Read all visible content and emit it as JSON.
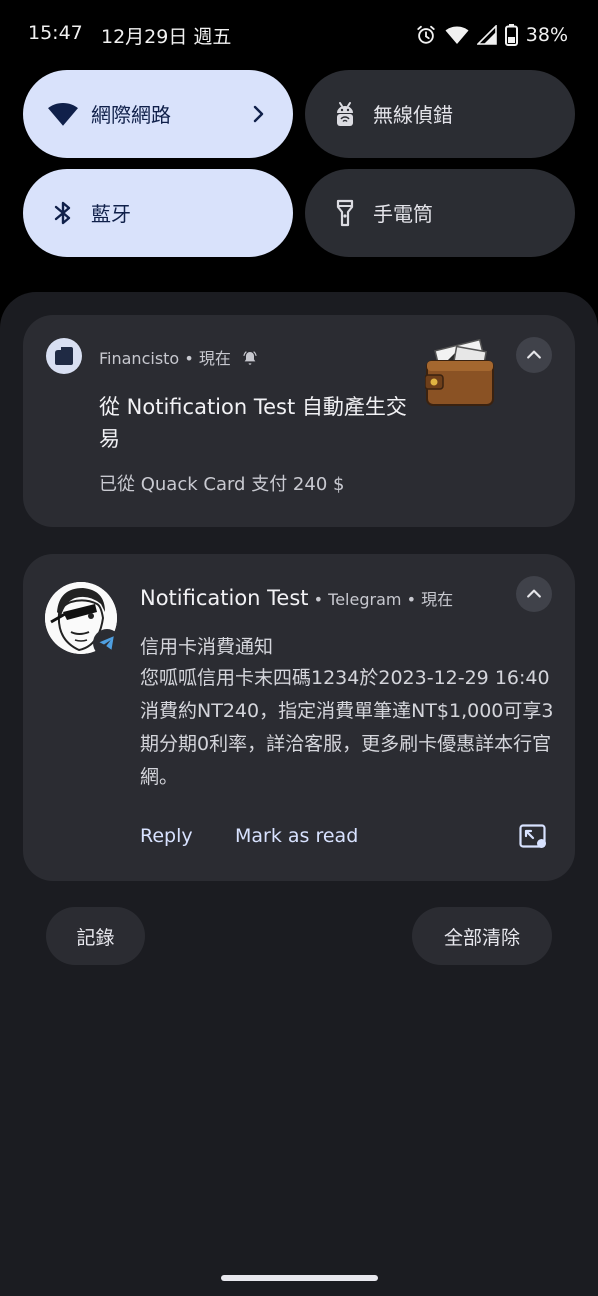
{
  "status_bar": {
    "time": "15:47",
    "date": "12月29日 週五",
    "battery": "38%",
    "icons": [
      "alarm-icon",
      "wifi-icon",
      "cell-signal-icon",
      "battery-icon"
    ]
  },
  "quick_settings": {
    "tiles": [
      {
        "label": "網際網路",
        "icon": "wifi-icon",
        "state": "active"
      },
      {
        "label": "無線偵錯",
        "icon": "android-debug-icon",
        "state": "inactive"
      },
      {
        "label": "藍牙",
        "icon": "bluetooth-icon",
        "state": "active"
      },
      {
        "label": "手電筒",
        "icon": "flashlight-icon",
        "state": "inactive"
      }
    ]
  },
  "notifications": [
    {
      "app": "Financisto",
      "time": "現在",
      "title": "從 Notification Test 自動產生交易",
      "body": "已從 Quack Card 支付 240 $"
    },
    {
      "sender": "Notification Test",
      "app": "Telegram",
      "time": "現在",
      "message_title": "信用卡消費通知",
      "message_body": "您呱呱信用卡末四碼1234於2023-12-29 16:40消費約NT240，指定消費單筆達NT$1,000可享3期分期0利率，詳洽客服，更多刷卡優惠詳本行官網。",
      "actions": [
        "Reply",
        "Mark as read"
      ]
    }
  ],
  "footer": {
    "history_label": "記錄",
    "clear_all_label": "全部清除"
  },
  "colors": {
    "active_tile": "#d9e2fb",
    "inactive_tile": "#2b2d33",
    "card": "#2b2c32",
    "shade": "#1b1c21",
    "accent_text": "#d8e2ff",
    "telegram_blue": "#4f9fe0"
  }
}
